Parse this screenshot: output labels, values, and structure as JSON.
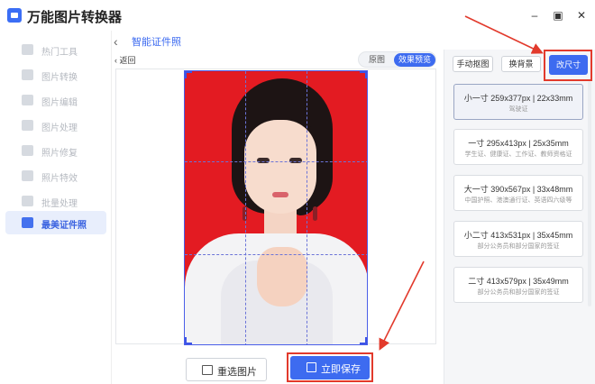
{
  "app": {
    "title": "万能图片转换器"
  },
  "window_controls": {
    "minimize": "–",
    "maximize": "▣",
    "close": "✕"
  },
  "sidebar": {
    "items": [
      {
        "label": "热门工具",
        "active": false
      },
      {
        "label": "图片转换",
        "active": false
      },
      {
        "label": "图片编辑",
        "active": false
      },
      {
        "label": "图片处理",
        "active": false
      },
      {
        "label": "照片修复",
        "active": false
      },
      {
        "label": "照片特效",
        "active": false
      },
      {
        "label": "批量处理",
        "active": false
      },
      {
        "label": "最美证件照",
        "active": true
      }
    ]
  },
  "header": {
    "back_chevron": "‹",
    "tab_label": "智能证件照"
  },
  "canvas": {
    "back_label": "‹  返回",
    "toggle": {
      "original": "原图",
      "preview": "效果预览"
    }
  },
  "buttons": {
    "reselect": "重选图片",
    "save": "立即保存"
  },
  "right_panel": {
    "manual_cutout": "手动抠图",
    "change_bg": "换背景",
    "resize": "改尺寸",
    "sizes": [
      {
        "title": "小一寸 259x377px | 22x33mm",
        "sub": "驾驶证",
        "selected": true
      },
      {
        "title": "一寸 295x413px | 25x35mm",
        "sub": "学生证、健康证、工作证、教师资格证",
        "selected": false
      },
      {
        "title": "大一寸 390x567px | 33x48mm",
        "sub": "中国护照、港澳通行证、英语四六级等",
        "selected": false
      },
      {
        "title": "小二寸 413x531px | 35x45mm",
        "sub": "部分公务员和部分国家的签证",
        "selected": false
      },
      {
        "title": "二寸 413x579px | 35x49mm",
        "sub": "部分公务员和部分国家的签证",
        "selected": false
      }
    ]
  },
  "colors": {
    "accent": "#3d6bf0",
    "photo_background": "#e31b22",
    "annotation": "#e23a2c"
  }
}
